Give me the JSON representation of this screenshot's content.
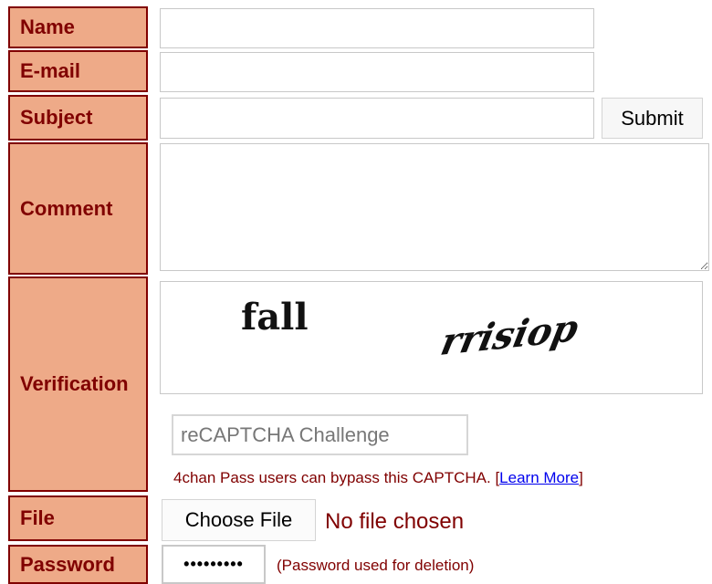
{
  "labels": {
    "name": "Name",
    "email": "E-mail",
    "subject": "Subject",
    "comment": "Comment",
    "verification": "Verification",
    "file": "File",
    "password": "Password"
  },
  "inputs": {
    "name_value": "",
    "email_value": "",
    "subject_value": "",
    "comment_value": "",
    "password_value": "•••••••••"
  },
  "buttons": {
    "submit": "Submit",
    "choose_file": "Choose File"
  },
  "captcha": {
    "words": [
      "fall",
      "rrisiop"
    ],
    "challenge_placeholder": "reCAPTCHA Challenge",
    "pass_note": "4chan Pass users can bypass this CAPTCHA.",
    "bracket_open": "[",
    "learn_more": "Learn More",
    "bracket_close": "]"
  },
  "file": {
    "status": "No file chosen"
  },
  "password": {
    "note": "(Password used for deletion)"
  },
  "colors": {
    "label_bg": "#eeaa88",
    "label_text": "#800000",
    "link": "#0000ee"
  }
}
